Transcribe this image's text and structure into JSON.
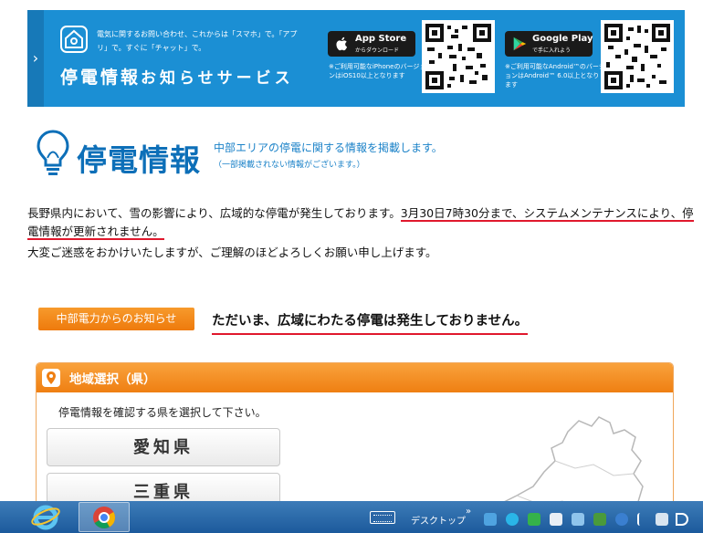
{
  "banner": {
    "desc": "電気に関するお問い合わせ、これからは「スマホ」で。「アプリ」で。すぐに「チャット」で。",
    "title_main": "停電情報",
    "title_rest": "お知らせサービス",
    "appstore": {
      "sub": "",
      "name": "App Store",
      "caption": "からダウンロード",
      "note": "※ご利用可能なiPhoneのバージョンはiOS10以上となります"
    },
    "googleplay": {
      "name": "Google Play",
      "caption": "で手に入れよう",
      "note": "※ご利用可能なAndroid™のバージョンはAndroid™ 6.0以上となります"
    }
  },
  "header": {
    "title": "停電情報",
    "subtitle": "中部エリアの停電に関する情報を掲載します。",
    "subnote": "（一部掲載されない情報がございます。）"
  },
  "notice": {
    "part1": "長野県内において、雪の影響により、広域的な停電が発生しております。",
    "part2": "3月30日7時30分まで、システムメンテナンスにより、停電情報が更新されません。",
    "line2": "大変ご迷惑をおかけいたしますが、ご理解のほどよろしくお願い申し上げます。"
  },
  "chubu": {
    "badge": "中部電力からのお知らせ",
    "message": "ただいま、広域にわたる停電は発生しておりません。"
  },
  "region": {
    "heading": "地域選択（県）",
    "instruction": "停電情報を確認する県を選択して下さい。",
    "prefectures": [
      "愛知県",
      "三重県"
    ]
  },
  "taskbar": {
    "desktop_label": "デスクトップ",
    "chevron": "»"
  },
  "colors": {
    "banner_blue": "#1b8fd4",
    "title_blue": "#0d6fb8",
    "accent_orange": "#ef7f12",
    "underline_red": "#e0182d"
  }
}
